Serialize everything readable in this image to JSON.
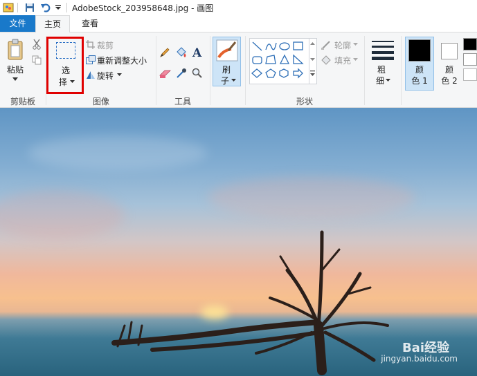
{
  "window": {
    "title": "AdobeStock_203958648.jpg - 画图"
  },
  "tabs": {
    "file": "文件",
    "home": "主页",
    "view": "查看"
  },
  "clipboard": {
    "paste": "粘贴",
    "label": "剪贴板"
  },
  "image": {
    "select_line1": "选",
    "select_line2": "择",
    "crop": "裁剪",
    "resize": "重新调整大小",
    "rotate": "旋转",
    "label": "图像"
  },
  "tools": {
    "label": "工具"
  },
  "brushes": {
    "line1": "刷",
    "line2": "子"
  },
  "shapes": {
    "outline": "轮廓",
    "fill": "填充",
    "label": "形状"
  },
  "size": {
    "line1": "粗",
    "line2": "细"
  },
  "colors": {
    "color1_line1": "颜",
    "color1_line2": "色 1",
    "color2_line1": "颜",
    "color2_line2": "色 2",
    "color1": "#000000",
    "color2": "#ffffff"
  },
  "highlight": {
    "color": "#e00000"
  },
  "watermark": {
    "text": "Bai经验",
    "url": "jingyan.baidu.com"
  }
}
